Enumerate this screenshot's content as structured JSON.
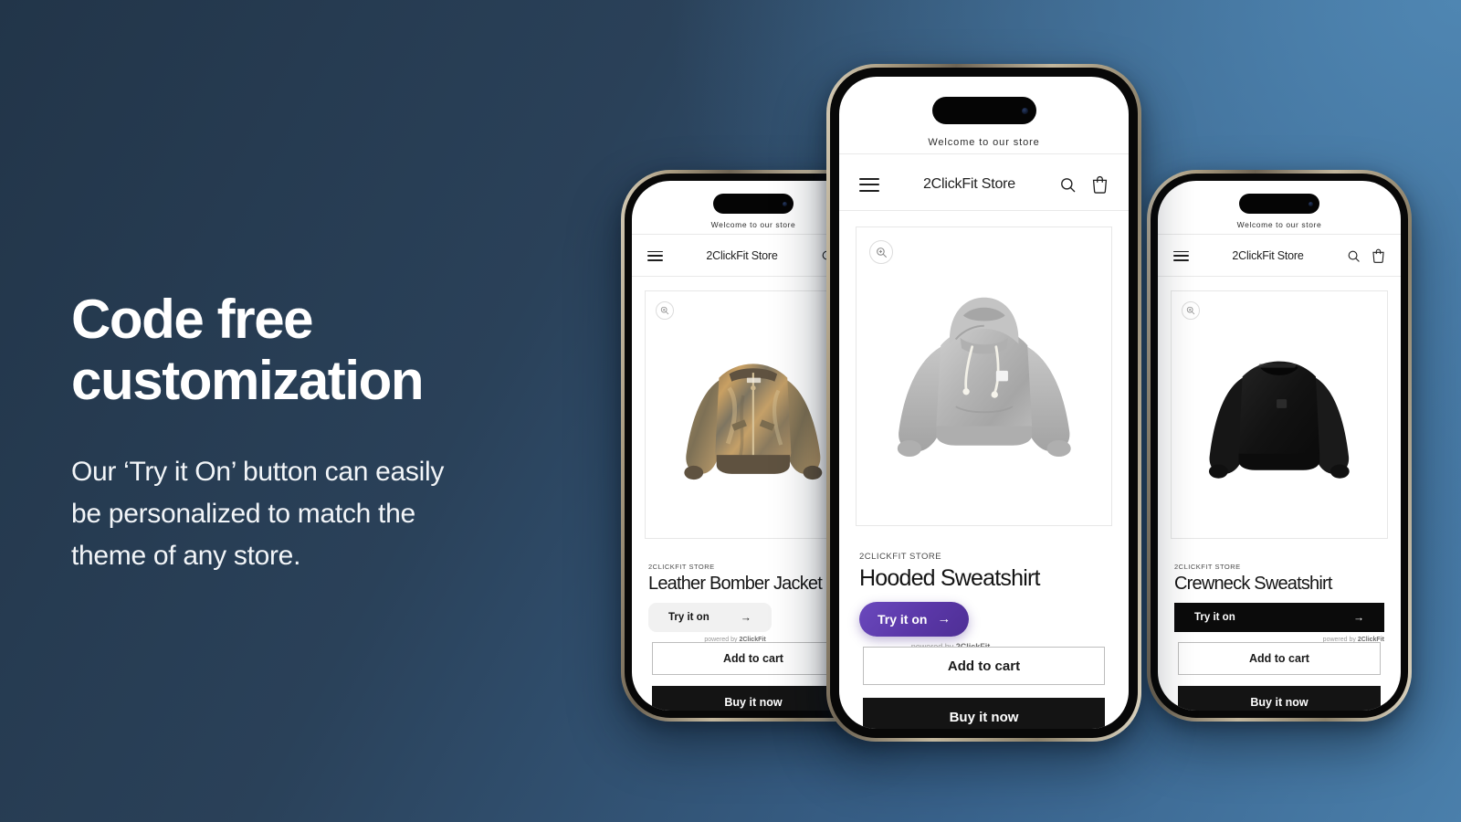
{
  "background": {
    "gradient_from": "#223549",
    "gradient_to": "#4f86b2"
  },
  "copy": {
    "headline": "Code free\ncustomization",
    "subcopy": "Our ‘Try it On’ button can easily\nbe personalized to match the\ntheme of any store."
  },
  "common": {
    "announcement": "Welcome to our store",
    "store_name": "2ClickFit Store",
    "vendor": "2CLICKFIT STORE",
    "try_on_label": "Try it on",
    "try_on_arrow": "→",
    "powered_prefix": "powered by ",
    "powered_brand": "2ClickFit",
    "add_to_cart": "Add to cart",
    "buy_it_now": "Buy it now",
    "menu_icon": "hamburger-icon",
    "search_icon": "search-icon",
    "cart_icon": "cart-icon",
    "zoom_icon": "zoom-in-icon"
  },
  "phones": {
    "left": {
      "product_title": "Leather Bomber Jacket",
      "button_style": "light-grey",
      "button_bg": "#f1f1f1",
      "button_text_color": "#141414",
      "product_image": "leather-bomber-jacket"
    },
    "center": {
      "product_title": "Hooded Sweatshirt",
      "button_style": "purple-pill",
      "button_bg": "#5a37a7",
      "button_text_color": "#ffffff",
      "product_image": "grey-hooded-sweatshirt"
    },
    "right": {
      "product_title": "Crewneck Sweatshirt",
      "button_style": "black-square",
      "button_bg": "#0b0b0b",
      "button_text_color": "#ffffff",
      "product_image": "black-crewneck-sweatshirt"
    }
  }
}
